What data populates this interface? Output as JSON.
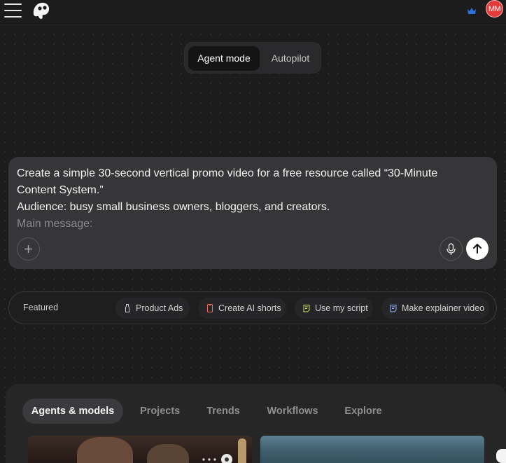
{
  "header": {
    "menu_icon": "hamburger-menu-icon",
    "logo_icon": "brand-logo-icon",
    "crown_icon": "crown-icon",
    "avatar_initials": "MM",
    "colors": {
      "avatar_bg": "#e53a3a",
      "crown": "#2f6fe0"
    }
  },
  "mode_toggle": {
    "options": [
      "Agent mode",
      "Autopilot"
    ],
    "selected": "Agent mode"
  },
  "prompt": {
    "lines": [
      "Create a simple 30-second vertical promo video for a free resource called “30-Minute",
      "Content System.”",
      "Audience: busy small business owners, bloggers, and creators.",
      "Main message:"
    ],
    "add_icon": "plus-icon",
    "mic_icon": "microphone-icon",
    "send_icon": "arrow-up-icon"
  },
  "featured": {
    "label": "Featured",
    "chips": [
      {
        "label": "Product Ads",
        "icon": "bottle-icon"
      },
      {
        "label": "Create AI shorts",
        "icon": "phone-icon"
      },
      {
        "label": "Use my script",
        "icon": "script-icon"
      },
      {
        "label": "Make explainer video",
        "icon": "script-icon"
      }
    ]
  },
  "bottom_tabs": {
    "items": [
      "Agents & models",
      "Projects",
      "Trends",
      "Workflows",
      "Explore"
    ],
    "selected": "Agents & models"
  }
}
